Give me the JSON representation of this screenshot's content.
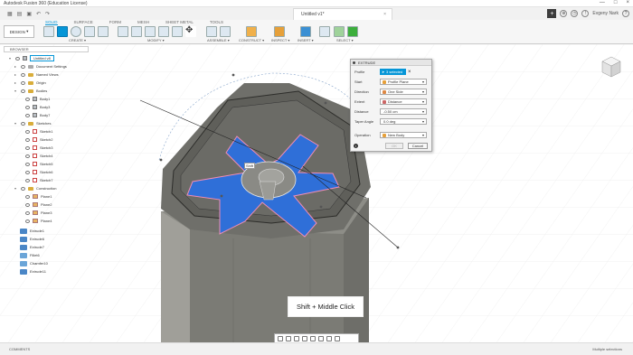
{
  "window": {
    "title": "Autodesk Fusion 360 (Education License)",
    "controls": [
      "—",
      "□",
      "×"
    ]
  },
  "tabbar": {
    "doc_tab": "Untitled v1*",
    "user": "Evgeny Nark"
  },
  "toolbar": {
    "workspace": "DESIGN",
    "ribbon_tabs": [
      "SOLID",
      "SURFACE",
      "FORM",
      "MESH",
      "SHEET METAL",
      "TOOLS"
    ],
    "active_tab": "SOLID",
    "groups": [
      "CREATE",
      "MODIFY",
      "ASSEMBLE",
      "CONSTRUCT",
      "INSPECT",
      "INSERT",
      "SELECT"
    ]
  },
  "browser": {
    "header": "BROWSER",
    "items": [
      {
        "label": "Untitled v8",
        "level": 0,
        "icon": "document-icon"
      },
      {
        "label": "Document Settings",
        "level": 1,
        "icon": "gear-icon"
      },
      {
        "label": "Named Views",
        "level": 1,
        "icon": "folder-icon"
      },
      {
        "label": "Origin",
        "level": 1,
        "icon": "folder-icon"
      },
      {
        "label": "Bodies",
        "level": 1,
        "icon": "folder-icon"
      },
      {
        "label": "Body1",
        "level": 2,
        "icon": "body-icon"
      },
      {
        "label": "Body3",
        "level": 2,
        "icon": "body-icon"
      },
      {
        "label": "Body7",
        "level": 2,
        "icon": "body-icon"
      },
      {
        "label": "Sketches",
        "level": 1,
        "icon": "folder-icon"
      },
      {
        "label": "Sketch1",
        "level": 2,
        "icon": "sketch-icon"
      },
      {
        "label": "Sketch2",
        "level": 2,
        "icon": "sketch-icon"
      },
      {
        "label": "Sketch3",
        "level": 2,
        "icon": "sketch-icon"
      },
      {
        "label": "Sketch4",
        "level": 2,
        "icon": "sketch-icon"
      },
      {
        "label": "Sketch5",
        "level": 2,
        "icon": "sketch-icon"
      },
      {
        "label": "Sketch6",
        "level": 2,
        "icon": "sketch-icon"
      },
      {
        "label": "Sketch7",
        "level": 2,
        "icon": "sketch-icon"
      },
      {
        "label": "Construction",
        "level": 1,
        "icon": "folder-icon"
      },
      {
        "label": "Plane1",
        "level": 2,
        "icon": "plane-icon"
      },
      {
        "label": "Plane2",
        "level": 2,
        "icon": "plane-icon"
      },
      {
        "label": "Plane3",
        "level": 2,
        "icon": "plane-icon"
      },
      {
        "label": "Plane4",
        "level": 2,
        "icon": "plane-icon"
      }
    ],
    "timeline": [
      "Extrude1",
      "Extrude6",
      "Extrude7",
      "Fillet6",
      "Chamfer10",
      "Extrude11"
    ]
  },
  "extrude_panel": {
    "title": "EXTRUDE",
    "profile_label": "Profile",
    "profile_value": "3 selected",
    "start_label": "Start",
    "start_value": "Profile Plane",
    "direction_label": "Direction",
    "direction_value": "One Side",
    "extent_label": "Extent",
    "extent_value": "Distance",
    "distance_label": "Distance",
    "distance_value": "-0.50 cm",
    "taper_label": "Taper Angle",
    "taper_value": "0.0 deg",
    "operation_label": "Operation",
    "operation_value": "New Body",
    "ok": "OK",
    "cancel": "Cancel"
  },
  "viewport": {
    "shift_tag": "Shift",
    "tooltip": "Shift + Middle Click"
  },
  "status": {
    "comments": "COMMENTS",
    "selection": "Multiple selections"
  },
  "colors": {
    "accent": "#0696d7",
    "profile_fill": "#2f6fd8",
    "body_grey": "#8a8a84"
  }
}
